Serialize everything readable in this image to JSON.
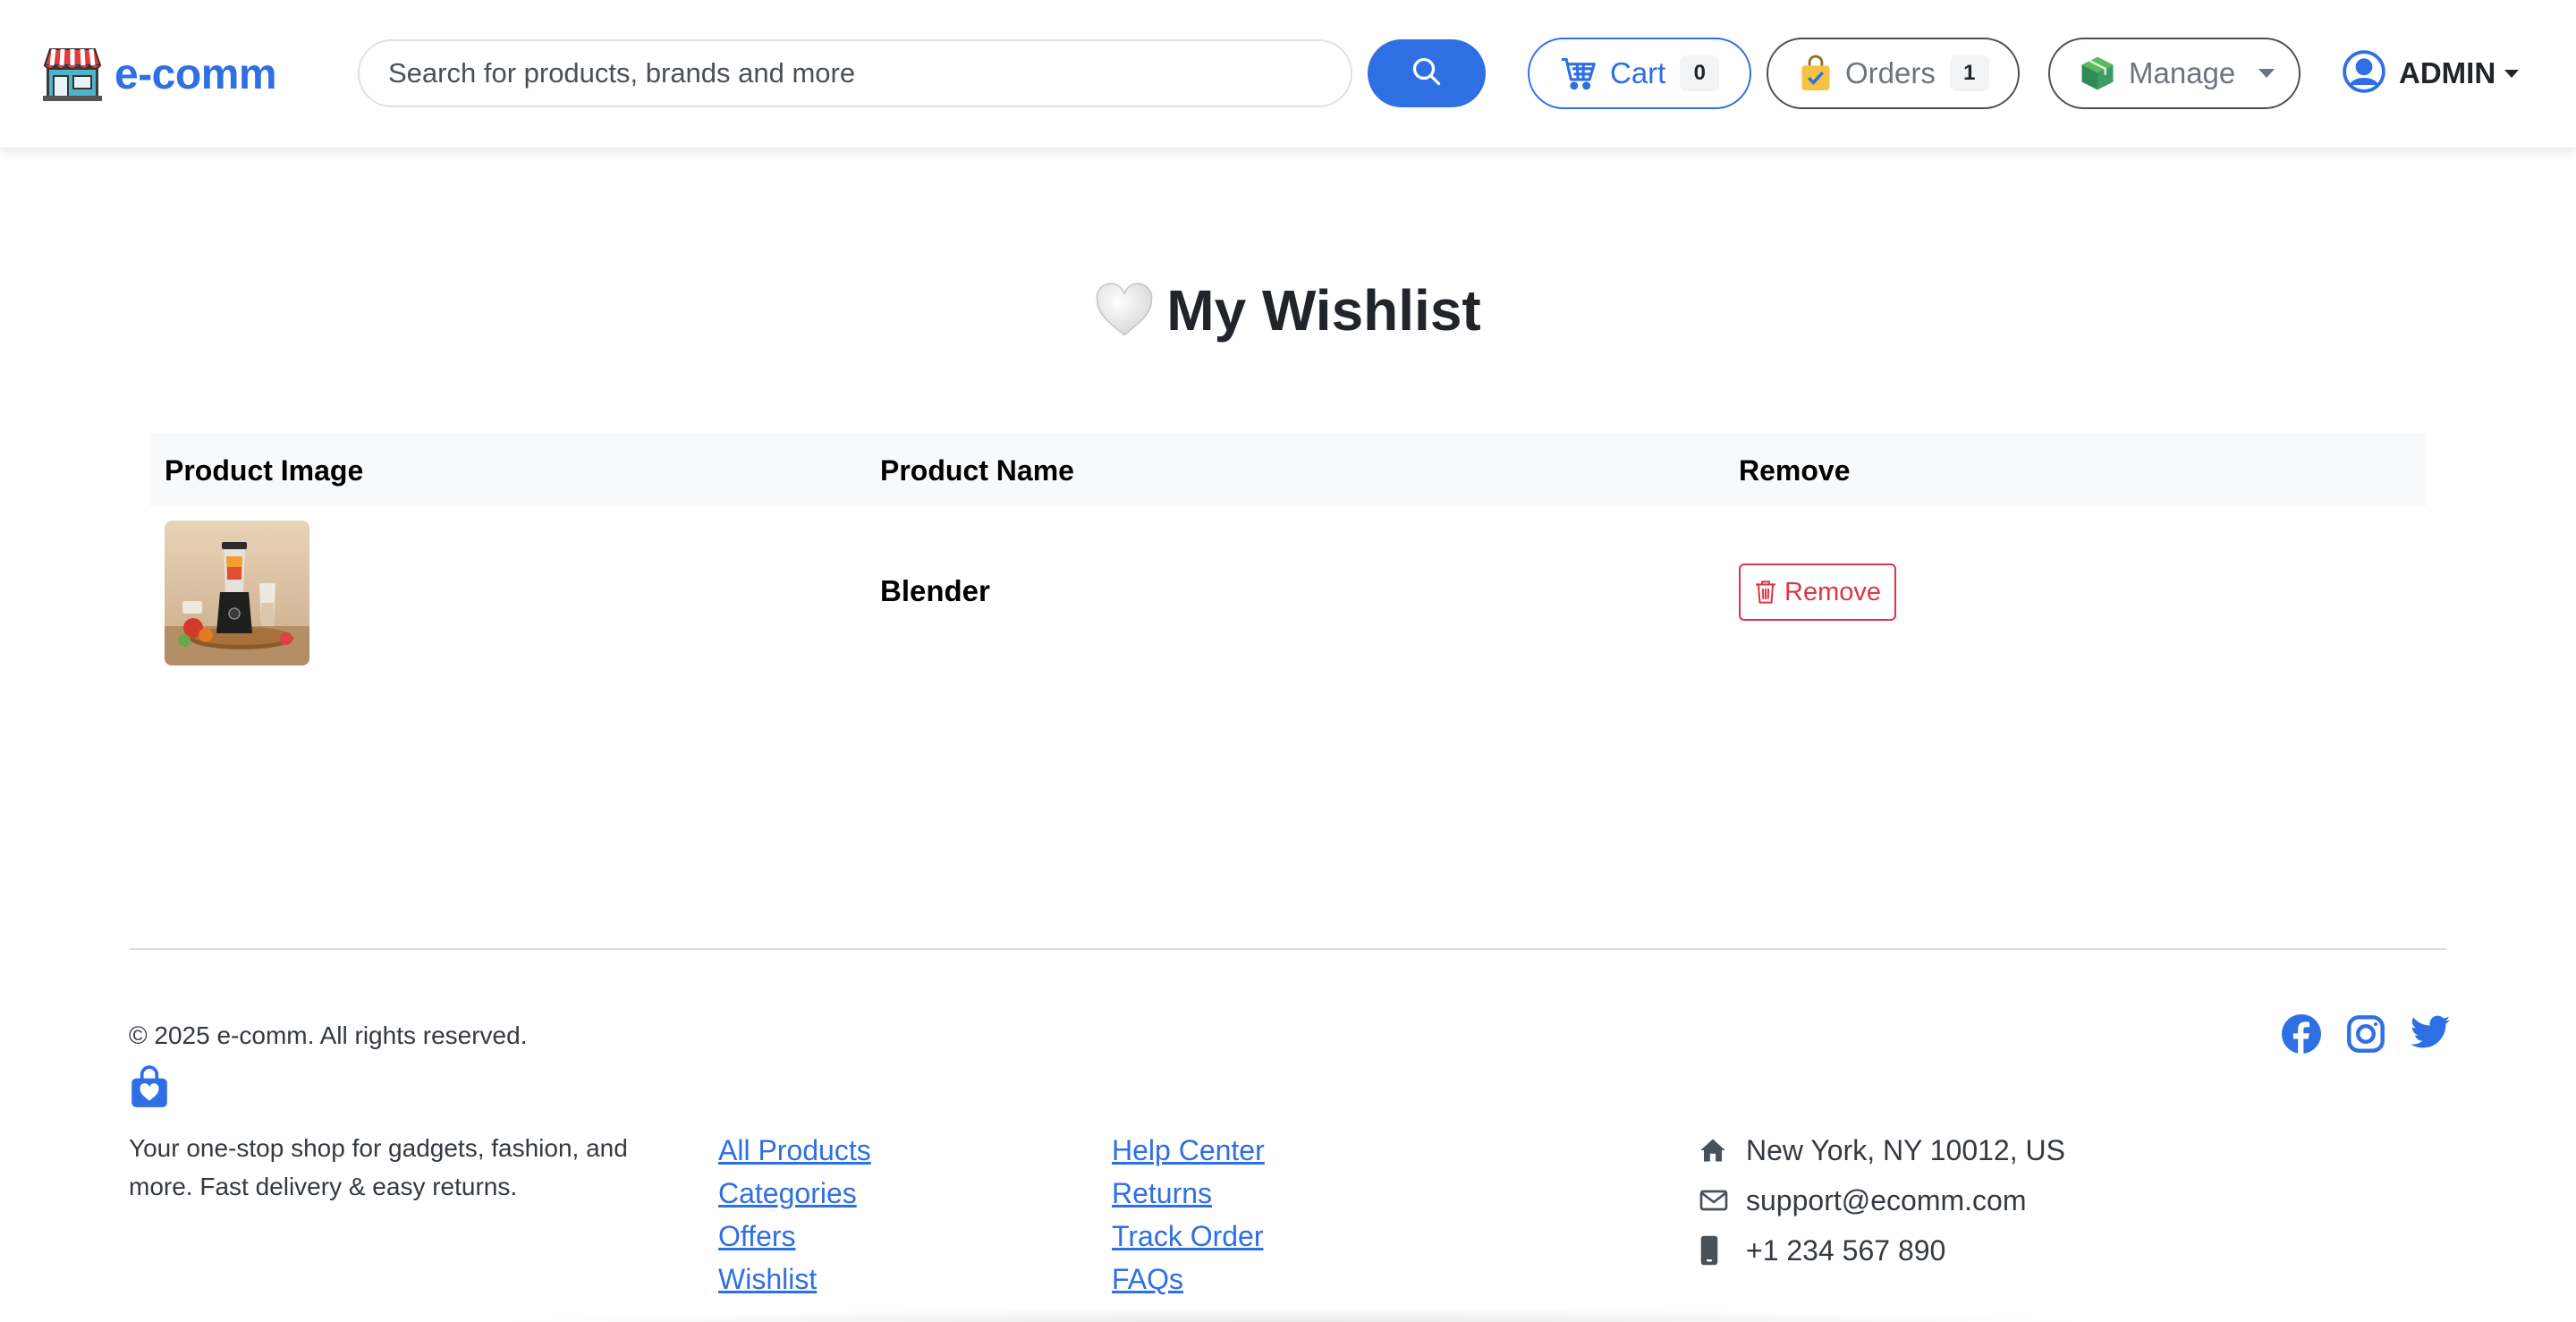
{
  "navbar": {
    "brand_name": "e-comm",
    "search": {
      "placeholder": "Search for products, brands and more",
      "value": ""
    },
    "cart": {
      "label": "Cart",
      "count": "0"
    },
    "orders": {
      "label": "Orders",
      "count": "1"
    },
    "manage": {
      "label": "Manage"
    },
    "user": {
      "label": "ADMIN"
    }
  },
  "icons": {
    "brand": "storefront-icon",
    "search": "search-icon",
    "cart": "cart-icon",
    "orders": "shopping-bag-icon",
    "manage": "box-icon",
    "user": "user-circle-icon",
    "title": "white-heart-icon",
    "remove": "trash-icon",
    "footer_brand": "bag-heart-icon",
    "address": "home-icon",
    "email": "envelope-icon",
    "phone": "phone-icon",
    "facebook": "facebook-icon",
    "instagram": "instagram-icon",
    "twitter": "twitter-icon"
  },
  "main": {
    "title": "My Wishlist",
    "table": {
      "headers": [
        "Product Image",
        "Product Name",
        "Remove"
      ],
      "rows": [
        {
          "product_name": "Blender",
          "remove_label": "Remove"
        }
      ]
    }
  },
  "footer": {
    "copyright": "© 2025 e-comm. All rights reserved.",
    "tagline": "Your one-stop shop for gadgets, fashion, and more. Fast delivery & easy returns.",
    "shop_links": [
      "All Products",
      "Categories",
      "Offers",
      "Wishlist"
    ],
    "help_links": [
      "Help Center",
      "Returns",
      "Track Order",
      "FAQs"
    ],
    "contact": {
      "address": "New York, NY 10012, US",
      "email": "support@ecomm.com",
      "phone": "+1 234 567 890"
    }
  },
  "colors": {
    "primary": "#2f6fe4",
    "danger": "#dc3545",
    "orders_icon": "#f5c242",
    "manage_icon": "#2e8b57",
    "text_dark": "#212529",
    "header_bg": "#f8f9fa"
  }
}
